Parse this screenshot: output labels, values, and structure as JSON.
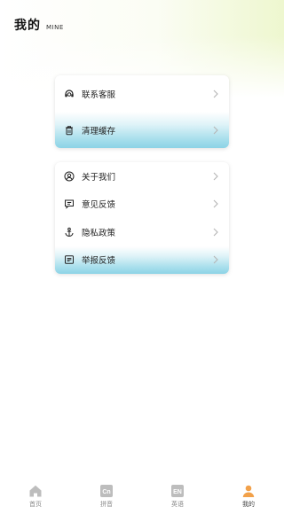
{
  "header": {
    "title": "我的",
    "subtitle": "MINE"
  },
  "card1": {
    "items": [
      {
        "label": "联系客服",
        "icon": "headset-icon"
      },
      {
        "label": "清理缓存",
        "icon": "trash-icon"
      }
    ]
  },
  "card2": {
    "items": [
      {
        "label": "关于我们",
        "icon": "user-circle-icon"
      },
      {
        "label": "意见反馈",
        "icon": "feedback-icon"
      },
      {
        "label": "隐私政策",
        "icon": "privacy-icon"
      },
      {
        "label": "举报反馈",
        "icon": "report-icon"
      }
    ]
  },
  "tabbar": {
    "tabs": [
      {
        "label": "首页",
        "icon": "home-icon"
      },
      {
        "label": "拼音",
        "icon": "cn-icon",
        "glyph": "Cn"
      },
      {
        "label": "英语",
        "icon": "en-icon",
        "glyph": "EN"
      },
      {
        "label": "我的",
        "icon": "person-icon"
      }
    ]
  },
  "colors": {
    "accent": "#f2a14a",
    "highlight": "#8cd3e6",
    "tab_inactive": "#bdbdbd"
  }
}
